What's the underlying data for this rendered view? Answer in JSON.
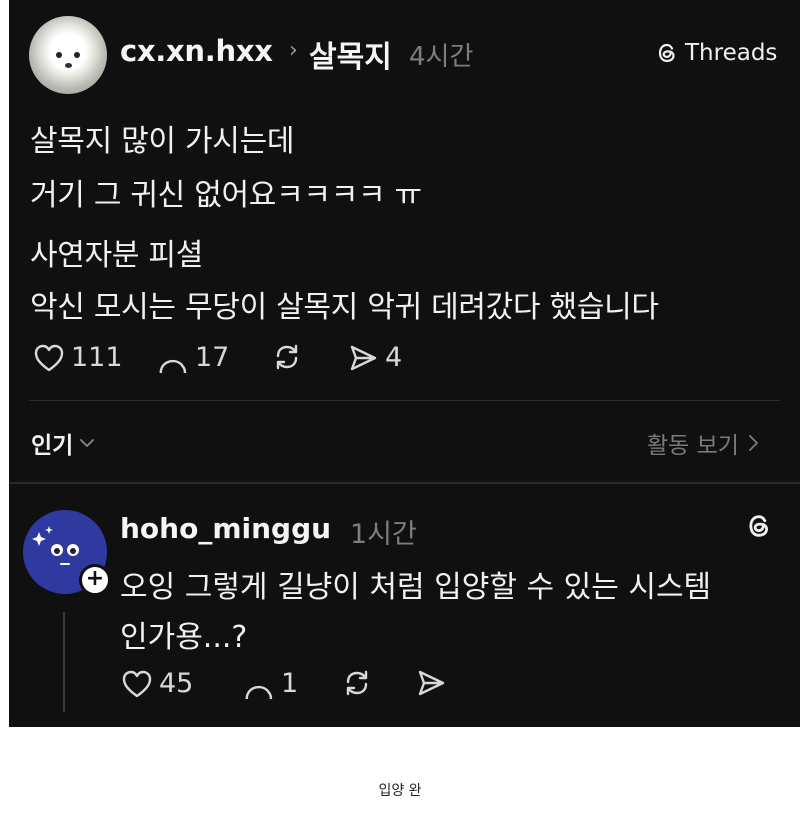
{
  "post": {
    "username": "cx.xn.hxx",
    "separator": "›",
    "forum": "살목지",
    "time": "4시간",
    "brand": "Threads",
    "lines": [
      "살목지 많이 가시는데",
      "거기 그 귀신 없어요ㅋㅋㅋㅋ ㅠ",
      "사연자분 피셜",
      "악신 모시는 무당이 살목지 악귀 데려갔다 했습니다"
    ],
    "likes": "111",
    "comments": "17",
    "shares": "4"
  },
  "sort": {
    "label": "인기",
    "activity_label": "활동 보기"
  },
  "reply": {
    "username": "hoho_minggu",
    "time": "1시간",
    "lines": [
      "오잉 그렇게 길냥이 처럼 입양할 수 있는 시스템",
      "인가용...?"
    ],
    "likes": "45",
    "comments": "1"
  },
  "caption": "입양 완",
  "icons": [
    "heart-icon",
    "comment-icon",
    "repost-icon",
    "send-icon",
    "threads-logo-icon",
    "chevron-down-icon",
    "chevron-right-icon",
    "plus-icon"
  ],
  "colors": {
    "panel_bg": "#101010",
    "avatar_blue": "#2f3aa0",
    "muted": "#7d7d7d"
  }
}
